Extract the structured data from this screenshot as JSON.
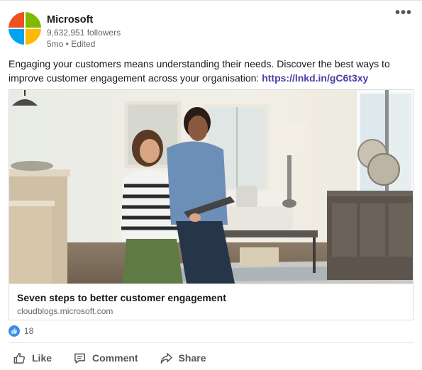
{
  "author": {
    "name": "Microsoft",
    "followers": "9,632,951 followers",
    "meta": "5mo • Edited",
    "logo_colors": [
      "#f25022",
      "#7fba00",
      "#00a4ef",
      "#ffb900"
    ]
  },
  "more_menu": {
    "label": "•••"
  },
  "post": {
    "text": "Engaging your customers means understanding their needs. Discover the best ways to improve customer engagement across your organisation: ",
    "link": "https://lnkd.in/gC6t3xy"
  },
  "article": {
    "image_alt": "Two people in a furniture store reviewing a tablet",
    "title": "Seven steps to better customer engagement",
    "domain": "cloudblogs.microsoft.com"
  },
  "reactions": {
    "icon": "like-icon",
    "count": "18"
  },
  "actions": [
    {
      "label": "Like",
      "icon": "thumbs-up-icon"
    },
    {
      "label": "Comment",
      "icon": "comment-icon"
    },
    {
      "label": "Share",
      "icon": "share-icon"
    }
  ]
}
